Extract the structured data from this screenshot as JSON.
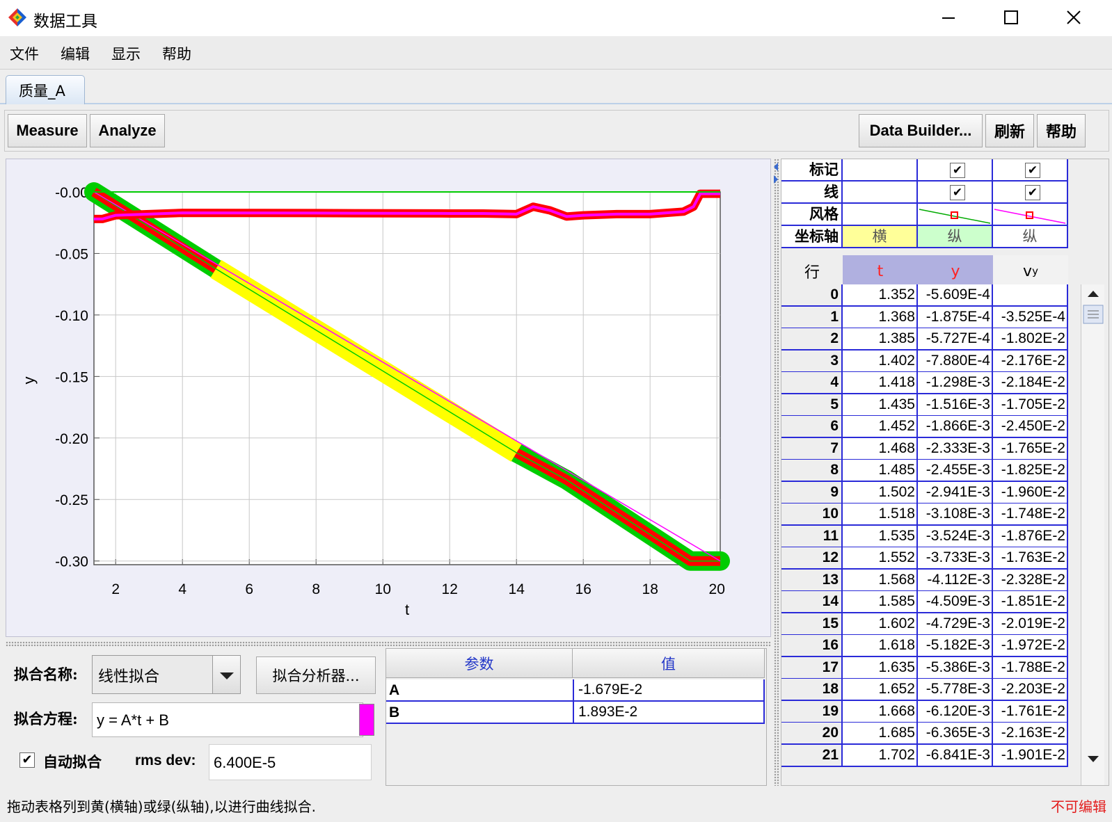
{
  "window": {
    "title": "数据工具"
  },
  "menu": [
    "文件",
    "编辑",
    "显示",
    "帮助"
  ],
  "tab": {
    "label": "质量_A"
  },
  "toolbar": {
    "measure": "Measure",
    "analyze": "Analyze",
    "data_builder": "Data Builder...",
    "refresh": "刷新",
    "help": "帮助"
  },
  "chart_data": {
    "type": "scatter",
    "xlabel": "t",
    "ylabel": "y",
    "xticks": [
      2,
      4,
      6,
      8,
      10,
      12,
      14,
      16,
      18,
      20
    ],
    "yticks": [
      "-0.00",
      "-0.05",
      "-0.10",
      "-0.15",
      "-0.20",
      "-0.25",
      "-0.30"
    ],
    "xlim": [
      1.35,
      20.1
    ],
    "ylim": [
      -0.303,
      0.0
    ],
    "grid": true,
    "series": [
      {
        "column": "y",
        "color": "#00cc00",
        "marker_color": "#ff0000",
        "x": [
          1.35,
          5.0,
          14.0,
          15.5,
          19.2,
          19.5,
          20.1
        ],
        "y": [
          0.0,
          -0.0625,
          -0.212,
          -0.234,
          -0.3,
          -0.3,
          -0.3
        ]
      },
      {
        "column": "vy",
        "color": "#ff00ff",
        "marker_color": "#ff0000",
        "x": [
          1.35,
          1.6,
          2.0,
          4.0,
          8.0,
          12.0,
          13.0,
          14.0,
          14.5,
          15.0,
          15.5,
          16.0,
          17.0,
          18.0,
          19.0,
          19.3,
          19.5,
          20.1
        ],
        "y": [
          -0.022,
          -0.022,
          -0.019,
          -0.017,
          -0.0172,
          -0.0175,
          -0.0175,
          -0.018,
          -0.012,
          -0.015,
          -0.02,
          -0.019,
          -0.018,
          -0.018,
          -0.016,
          -0.012,
          -0.0015,
          -0.0015
        ]
      },
      {
        "name": "线性拟合",
        "type": "line",
        "color": "#ff00ff",
        "x": [
          1.35,
          20.1
        ],
        "y": [
          0.0,
          -0.3
        ]
      }
    ],
    "highlight": {
      "color": "#ffff00",
      "x": [
        5.0,
        14.0
      ]
    }
  },
  "fit": {
    "name_label": "拟合名称:",
    "name_value": "线性拟合",
    "analyzer_button": "拟合分析器...",
    "equation_label": "拟合方程:",
    "equation": "y = A*t + B",
    "swatch_color": "#ff00ff",
    "autofit_check": "✔",
    "autofit_label": "自动拟合",
    "rms_label": "rms dev:",
    "rms_value": "6.400E-5"
  },
  "params": {
    "headers": [
      "参数",
      "值"
    ],
    "rows": [
      {
        "name": "A",
        "value": "-1.679E-2"
      },
      {
        "name": "B",
        "value": "1.893E-2"
      }
    ]
  },
  "table": {
    "attr_labels": [
      "标记",
      "线",
      "风格",
      "坐标轴"
    ],
    "check": "✔",
    "axis_values": [
      "横",
      "纵",
      "纵"
    ],
    "axis_colors": [
      "#ffff99",
      "#ccffcc",
      "#ffffff"
    ],
    "style_colors": [
      "#00aa00",
      "#ff00ff"
    ],
    "headers": {
      "row": "行",
      "t": "t",
      "y": "y",
      "vy_base": "v",
      "vy_sub": "y"
    },
    "rows": [
      [
        "0",
        "1.352",
        "-5.609E-4",
        ""
      ],
      [
        "1",
        "1.368",
        "-1.875E-4",
        "-3.525E-4"
      ],
      [
        "2",
        "1.385",
        "-5.727E-4",
        "-1.802E-2"
      ],
      [
        "3",
        "1.402",
        "-7.880E-4",
        "-2.176E-2"
      ],
      [
        "4",
        "1.418",
        "-1.298E-3",
        "-2.184E-2"
      ],
      [
        "5",
        "1.435",
        "-1.516E-3",
        "-1.705E-2"
      ],
      [
        "6",
        "1.452",
        "-1.866E-3",
        "-2.450E-2"
      ],
      [
        "7",
        "1.468",
        "-2.333E-3",
        "-1.765E-2"
      ],
      [
        "8",
        "1.485",
        "-2.455E-3",
        "-1.825E-2"
      ],
      [
        "9",
        "1.502",
        "-2.941E-3",
        "-1.960E-2"
      ],
      [
        "10",
        "1.518",
        "-3.108E-3",
        "-1.748E-2"
      ],
      [
        "11",
        "1.535",
        "-3.524E-3",
        "-1.876E-2"
      ],
      [
        "12",
        "1.552",
        "-3.733E-3",
        "-1.763E-2"
      ],
      [
        "13",
        "1.568",
        "-4.112E-3",
        "-2.328E-2"
      ],
      [
        "14",
        "1.585",
        "-4.509E-3",
        "-1.851E-2"
      ],
      [
        "15",
        "1.602",
        "-4.729E-3",
        "-2.019E-2"
      ],
      [
        "16",
        "1.618",
        "-5.182E-3",
        "-1.972E-2"
      ],
      [
        "17",
        "1.635",
        "-5.386E-3",
        "-1.788E-2"
      ],
      [
        "18",
        "1.652",
        "-5.778E-3",
        "-2.203E-2"
      ],
      [
        "19",
        "1.668",
        "-6.120E-3",
        "-1.761E-2"
      ],
      [
        "20",
        "1.685",
        "-6.365E-3",
        "-2.163E-2"
      ],
      [
        "21",
        "1.702",
        "-6.841E-3",
        "-1.901E-2"
      ]
    ]
  },
  "status": {
    "hint": "拖动表格列到黄(横轴)或绿(纵轴),以进行曲线拟合.",
    "readonly": "不可编辑"
  }
}
